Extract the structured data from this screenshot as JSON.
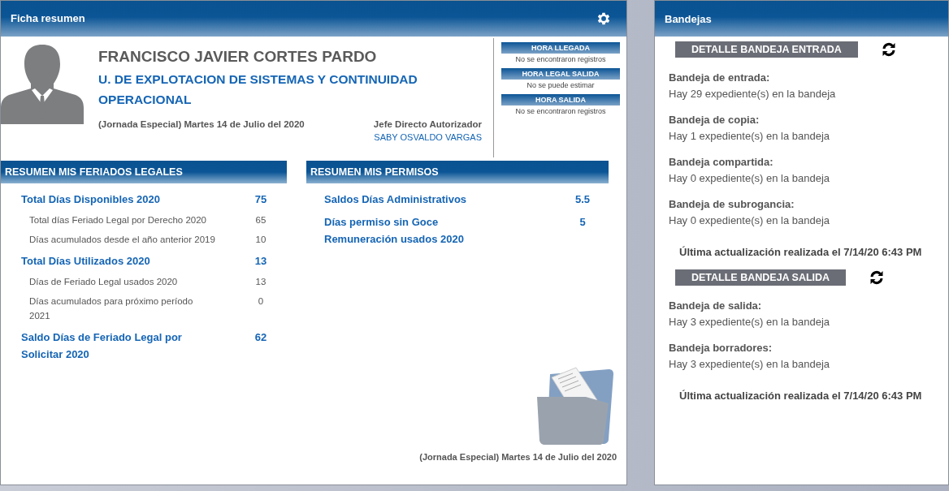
{
  "ficha": {
    "title": "Ficha resumen",
    "name": "FRANCISCO JAVIER CORTES PARDO",
    "unit": "U. DE EXPLOTACION DE SISTEMAS Y CONTINUIDAD OPERACIONAL",
    "date": "(Jornada Especial) Martes 14 de Julio del 2020",
    "jefe_label": "Jefe Directo Autorizador",
    "jefe_name": "SABY OSVALDO VARGAS",
    "horas": [
      {
        "title": "HORA LLEGADA",
        "value": "No se encontraron registros"
      },
      {
        "title": "HORA LEGAL SALIDA",
        "value": "No se puede estimar"
      },
      {
        "title": "HORA SALIDA",
        "value": "No se encontraron registros"
      }
    ],
    "feriados": {
      "title": "RESUMEN MIS FERIADOS LEGALES",
      "rows": [
        {
          "kind": "total",
          "label": "Total Días Disponibles 2020",
          "value": "75"
        },
        {
          "kind": "detail",
          "label": "Total días Feriado Legal por Derecho 2020",
          "value": "65"
        },
        {
          "kind": "detail",
          "label": "Días acumulados desde el año anterior 2019",
          "value": "10"
        },
        {
          "kind": "total",
          "label": "Total Días Utilizados 2020",
          "value": "13"
        },
        {
          "kind": "detail",
          "label": "Días de Feriado Legal usados 2020",
          "value": "13"
        },
        {
          "kind": "detail",
          "label": "Días acumulados para próximo período 2021",
          "value": "0"
        },
        {
          "kind": "total",
          "label": "Saldo Días de Feriado Legal por Solicitar 2020",
          "value": "62"
        }
      ]
    },
    "permisos": {
      "title": "RESUMEN MIS PERMISOS",
      "rows": [
        {
          "kind": "total",
          "label": "Saldos Días Administrativos",
          "value": "5.5"
        },
        {
          "kind": "total",
          "label": "Días permiso sin Goce Remuneración usados 2020",
          "value": "5"
        }
      ]
    },
    "footer_date": "(Jornada Especial) Martes 14 de Julio del 2020"
  },
  "bandejas": {
    "title": "Bandejas",
    "sections": [
      {
        "button": "DETALLE BANDEJA ENTRADA",
        "items": [
          {
            "label": "Bandeja de entrada:",
            "text": "Hay 29 expediente(s) en la bandeja"
          },
          {
            "label": "Bandeja de copia:",
            "text": "Hay 1 expediente(s) en la bandeja"
          },
          {
            "label": "Bandeja compartida:",
            "text": "Hay 0 expediente(s) en la bandeja"
          },
          {
            "label": "Bandeja de subrogancia:",
            "text": "Hay 0 expediente(s) en la bandeja"
          }
        ],
        "updated": "Última actualización realizada el 7/14/20 6:43 PM"
      },
      {
        "button": "DETALLE BANDEJA SALIDA",
        "items": [
          {
            "label": "Bandeja de salida:",
            "text": "Hay 3 expediente(s) en la bandeja"
          },
          {
            "label": "Bandeja borradores:",
            "text": "Hay 3 expediente(s) en la bandeja"
          }
        ],
        "updated": "Última actualización realizada el 7/14/20 6:43 PM"
      }
    ]
  }
}
